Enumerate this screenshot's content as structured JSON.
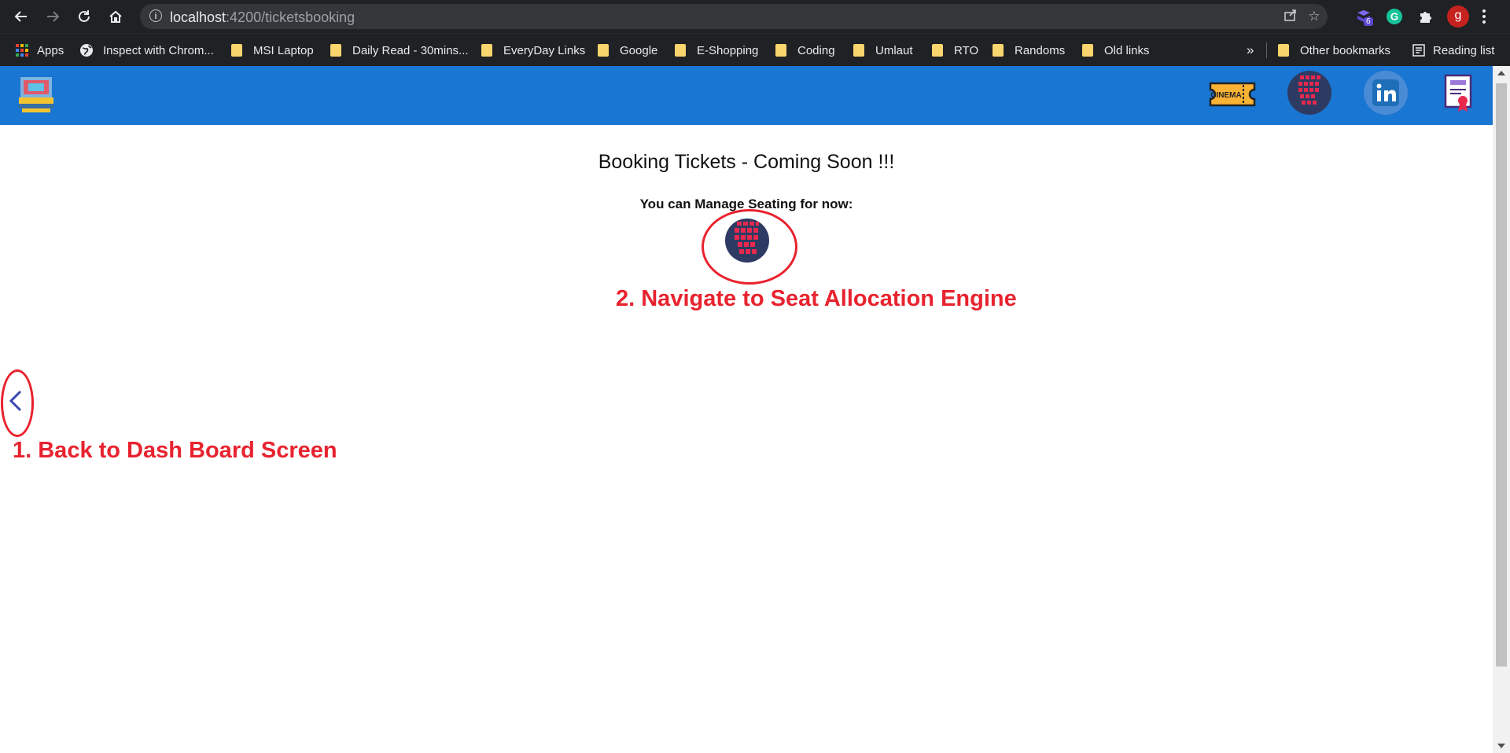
{
  "browser": {
    "url_host": "localhost",
    "url_path": ":4200/ticketsbooking",
    "profile_initial": "g",
    "extension_badge": "6",
    "icons": [
      "back-icon",
      "forward-icon",
      "reload-icon",
      "home-icon",
      "site-info-icon",
      "share-icon",
      "star-icon",
      "extensions-icon",
      "menu-icon"
    ]
  },
  "bookmarks": {
    "items": [
      {
        "label": "Apps",
        "icon": "apps-grid-icon"
      },
      {
        "label": "Inspect with Chrom...",
        "icon": "globe-icon"
      },
      {
        "label": "MSI Laptop",
        "icon": "folder-icon"
      },
      {
        "label": "Daily Read - 30mins...",
        "icon": "folder-icon"
      },
      {
        "label": "EveryDay Links",
        "icon": "folder-icon"
      },
      {
        "label": "Google",
        "icon": "folder-icon"
      },
      {
        "label": "E-Shopping",
        "icon": "folder-icon"
      },
      {
        "label": "Coding",
        "icon": "folder-icon"
      },
      {
        "label": "Umlaut",
        "icon": "folder-icon"
      },
      {
        "label": "RTO",
        "icon": "folder-icon"
      },
      {
        "label": "Randoms",
        "icon": "folder-icon"
      },
      {
        "label": "Old links",
        "icon": "folder-icon"
      }
    ],
    "overflow": "»",
    "other_label": "Other bookmarks",
    "reading_list_label": "Reading list"
  },
  "appbar": {
    "cinema_ticket_text": "CINEMA",
    "icons": [
      "app-logo-icon",
      "cinema-ticket-icon",
      "seat-map-icon",
      "linkedin-icon",
      "certificate-icon"
    ],
    "colors": {
      "background": "#1976d2"
    }
  },
  "main": {
    "title": "Booking Tickets - Coming Soon !!!",
    "subtitle": "You can Manage Seating for now:"
  },
  "annotations": {
    "back_note": "1. Back to Dash Board Screen",
    "seat_note": "2. Navigate to Seat Allocation Engine",
    "color": "#e8232f"
  }
}
